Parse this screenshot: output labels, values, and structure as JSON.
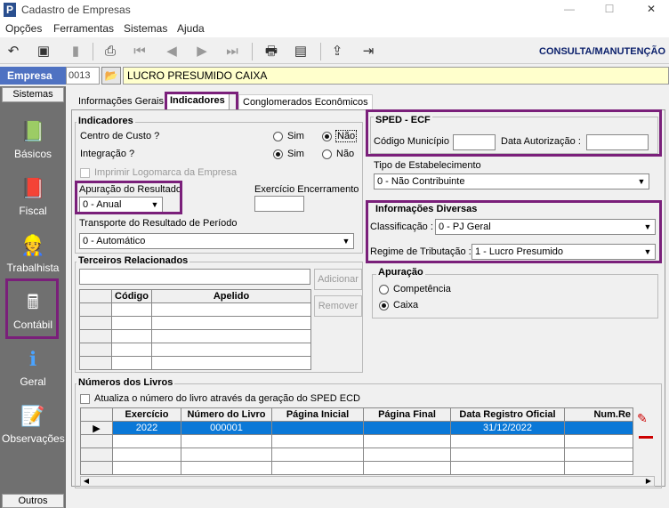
{
  "window": {
    "title": "Cadastro de Empresas",
    "controls": [
      "—",
      "☐",
      "✕"
    ]
  },
  "menu": [
    "Opções",
    "Ferramentas",
    "Sistemas",
    "Ajuda"
  ],
  "toolbar": {
    "icons": [
      "undo-icon",
      "save-icon",
      "bookmark-icon",
      "preview-icon",
      "first-icon",
      "prev-icon",
      "next-icon",
      "last-icon",
      "print-icon",
      "report-icon",
      "export-icon",
      "exit-icon"
    ],
    "mode": "CONSULTA/MANUTENÇÃO"
  },
  "empresa": {
    "label": "Empresa",
    "code": "0013",
    "name": "LUCRO PRESUMIDO CAIXA"
  },
  "sidebar": {
    "title": "Sistemas",
    "items": [
      "Básicos",
      "Fiscal",
      "Trabalhista",
      "Contábil",
      "Geral",
      "Observações"
    ],
    "bottom": "Outros"
  },
  "tabs": [
    "Informações Gerais",
    "Indicadores",
    "Conglomerados Econômicos"
  ],
  "indicadores": {
    "title": "Indicadores",
    "centro_custo": "Centro de Custo ?",
    "integracao": "Integração ?",
    "sim": "Sim",
    "nao": "Não",
    "imprimir_logo": "Imprimir Logomarca da Empresa",
    "apuracao_label": "Apuração do Resultado",
    "apuracao_value": "0 - Anual",
    "exercicio_label": "Exercício Encerramento",
    "exercicio_value": "",
    "transporte_label": "Transporte do Resultado de Período",
    "transporte_value": "0 - Automático"
  },
  "terceiros": {
    "title": "Terceiros Relacionados",
    "col_codigo": "Código",
    "col_apelido": "Apelido",
    "adicionar": "Adicionar",
    "remover": "Remover"
  },
  "sped": {
    "title": "SPED - ECF",
    "codigo_municipio": "Código Município :",
    "data_autorizacao": "Data Autorização :",
    "tipo_label": "Tipo de Estabelecimento",
    "tipo_value": "0 - Não Contribuinte"
  },
  "info_diversas": {
    "title": "Informações Diversas",
    "classificacao_label": "Classificação :",
    "classificacao_value": "0 - PJ Geral",
    "regime_label": "Regime de Tributação :",
    "regime_value": "1 - Lucro Presumido"
  },
  "apuracao": {
    "title": "Apuração",
    "competencia": "Competência",
    "caixa": "Caixa"
  },
  "livros": {
    "title": "Números dos Livros",
    "atualiza": "Atualiza o número do livro através da geração do SPED ECD",
    "columns": [
      "Exercício",
      "Número do Livro",
      "Página Inicial",
      "Página Final",
      "Data Registro Oficial",
      "Num.Re"
    ],
    "row": [
      "2022",
      "000001",
      "",
      "",
      "31/12/2022",
      ""
    ]
  }
}
